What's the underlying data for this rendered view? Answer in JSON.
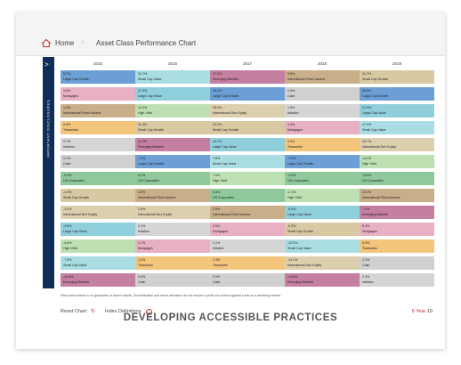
{
  "topbar": {
    "home_label": "Home",
    "page_title": "Asset Class Performance Chart"
  },
  "sidebar": {
    "label": "IMPORTANT DISCLOSURES",
    "arrow": ">"
  },
  "years": [
    "2015",
    "2016",
    "2017",
    "2018",
    "2019"
  ],
  "colors": {
    "Large Cap Growth": "#6b9fd6",
    "Large Cap Value": "#8fcfdc",
    "Mortgages": "#e8b0c3",
    "Small Cap Growth": "#d9c9a3",
    "Small Cap Value": "#a9dde3",
    "International Fixed Income": "#c9ae8a",
    "Emerging Markets": "#c57fa1",
    "International Dev Equity": "#dccfae",
    "High Yield": "#bde0b2",
    "Treasuries": "#f2c57b",
    "US Corporates": "#8fc89a",
    "Inflation": "#d5d5d5",
    "Cash": "#d0d0d0"
  },
  "columns": [
    [
      {
        "value": "5.7%",
        "name": "Large Cap Growth"
      },
      {
        "value": "1.5%",
        "name": "Mortgages"
      },
      {
        "value": "1.4%",
        "name": "International Fixed Income"
      },
      {
        "value": "0.8%",
        "name": "Treasuries"
      },
      {
        "value": "0.7%",
        "name": "Inflation"
      },
      {
        "value": "0.1%",
        "name": "Cash"
      },
      {
        "value": "-0.6%",
        "name": "US Corporates"
      },
      {
        "value": "-1.4%",
        "name": "Small Cap Growth"
      },
      {
        "value": "-3.0%",
        "name": "International Dev Equity"
      },
      {
        "value": "-3.8%",
        "name": "Large Cap Value"
      },
      {
        "value": "-4.6%",
        "name": "High Yield"
      },
      {
        "value": "-7.5%",
        "name": "Small Cap Value"
      },
      {
        "value": "-14.9%",
        "name": "Emerging Markets"
      }
    ],
    [
      {
        "value": "31.7%",
        "name": "Small Cap Value"
      },
      {
        "value": "17.3%",
        "name": "Large Cap Value"
      },
      {
        "value": "14.3%",
        "name": "High Yield"
      },
      {
        "value": "11.3%",
        "name": "Small Cap Growth"
      },
      {
        "value": "11.2%",
        "name": "Emerging Markets"
      },
      {
        "value": "7.1%",
        "name": "Large Cap Growth"
      },
      {
        "value": "6.1%",
        "name": "US Corporates"
      },
      {
        "value": "4.9%",
        "name": "International Fixed Income"
      },
      {
        "value": "2.8%",
        "name": "International Dev Equity"
      },
      {
        "value": "2.1%",
        "name": "Inflation"
      },
      {
        "value": "1.7%",
        "name": "Mortgages"
      },
      {
        "value": "1.0%",
        "name": "Treasuries"
      },
      {
        "value": "0.3%",
        "name": "Cash"
      }
    ],
    [
      {
        "value": "37.3%",
        "name": "Emerging Markets"
      },
      {
        "value": "30.2%",
        "name": "Large Cap Growth"
      },
      {
        "value": "25.0%",
        "name": "International Dev Equity"
      },
      {
        "value": "22.2%",
        "name": "Small Cap Growth"
      },
      {
        "value": "13.7%",
        "name": "Large Cap Value"
      },
      {
        "value": "7.8%",
        "name": "Small Cap Value"
      },
      {
        "value": "7.5%",
        "name": "High Yield"
      },
      {
        "value": "6.4%",
        "name": "US Corporates"
      },
      {
        "value": "2.5%",
        "name": "International Fixed Income"
      },
      {
        "value": "2.5%",
        "name": "Mortgages"
      },
      {
        "value": "2.1%",
        "name": "Inflation"
      },
      {
        "value": "2.3%",
        "name": "Treasuries"
      },
      {
        "value": "0.9%",
        "name": "Cash"
      }
    ],
    [
      {
        "value": "3.6%",
        "name": "International Fixed Income"
      },
      {
        "value": "1.9%",
        "name": "Cash"
      },
      {
        "value": "1.9%",
        "name": "Inflation"
      },
      {
        "value": "1.0%",
        "name": "Mortgages"
      },
      {
        "value": "0.9%",
        "name": "Treasuries"
      },
      {
        "value": "-1.5%",
        "name": "Large Cap Growth"
      },
      {
        "value": "-2.5%",
        "name": "US Corporates"
      },
      {
        "value": "-2.1%",
        "name": "High Yield"
      },
      {
        "value": "-8.3%",
        "name": "Large Cap Value"
      },
      {
        "value": "-9.3%",
        "name": "Small Cap Growth"
      },
      {
        "value": "-12.9%",
        "name": "Small Cap Value"
      },
      {
        "value": "-14.1%",
        "name": "International Dev Equity"
      },
      {
        "value": "-14.6%",
        "name": "Emerging Markets"
      }
    ],
    [
      {
        "value": "31.7%",
        "name": "Small Cap Growth"
      },
      {
        "value": "26.5%",
        "name": "Large Cap Growth"
      },
      {
        "value": "21.9%",
        "name": "Large Cap Value"
      },
      {
        "value": "17.9%",
        "name": "Small Cap Value"
      },
      {
        "value": "15.7%",
        "name": "International Dev Equity"
      },
      {
        "value": "14.2%",
        "name": "High Yield"
      },
      {
        "value": "13.5%",
        "name": "US Corporates"
      },
      {
        "value": "10.4%",
        "name": "International Fixed Income"
      },
      {
        "value": "7.0%",
        "name": "Emerging Markets"
      },
      {
        "value": "6.4%",
        "name": "Mortgages"
      },
      {
        "value": "6.9%",
        "name": "Treasuries"
      },
      {
        "value": "2.3%",
        "name": "Cash"
      },
      {
        "value": "2.3%",
        "name": "Inflation"
      }
    ]
  ],
  "footnote": "Past performance is no guarantee of future results. Diversification and asset allocation do not ensure a profit nor protect against a loss in a declining market.",
  "bottombar": {
    "reset_label": "Reset Chart",
    "definitions_label": "Index Definitions",
    "range_active": "5 Year",
    "range_other": "10"
  },
  "caption": "DEVELOPING ACCESSIBLE PRACTICES"
}
